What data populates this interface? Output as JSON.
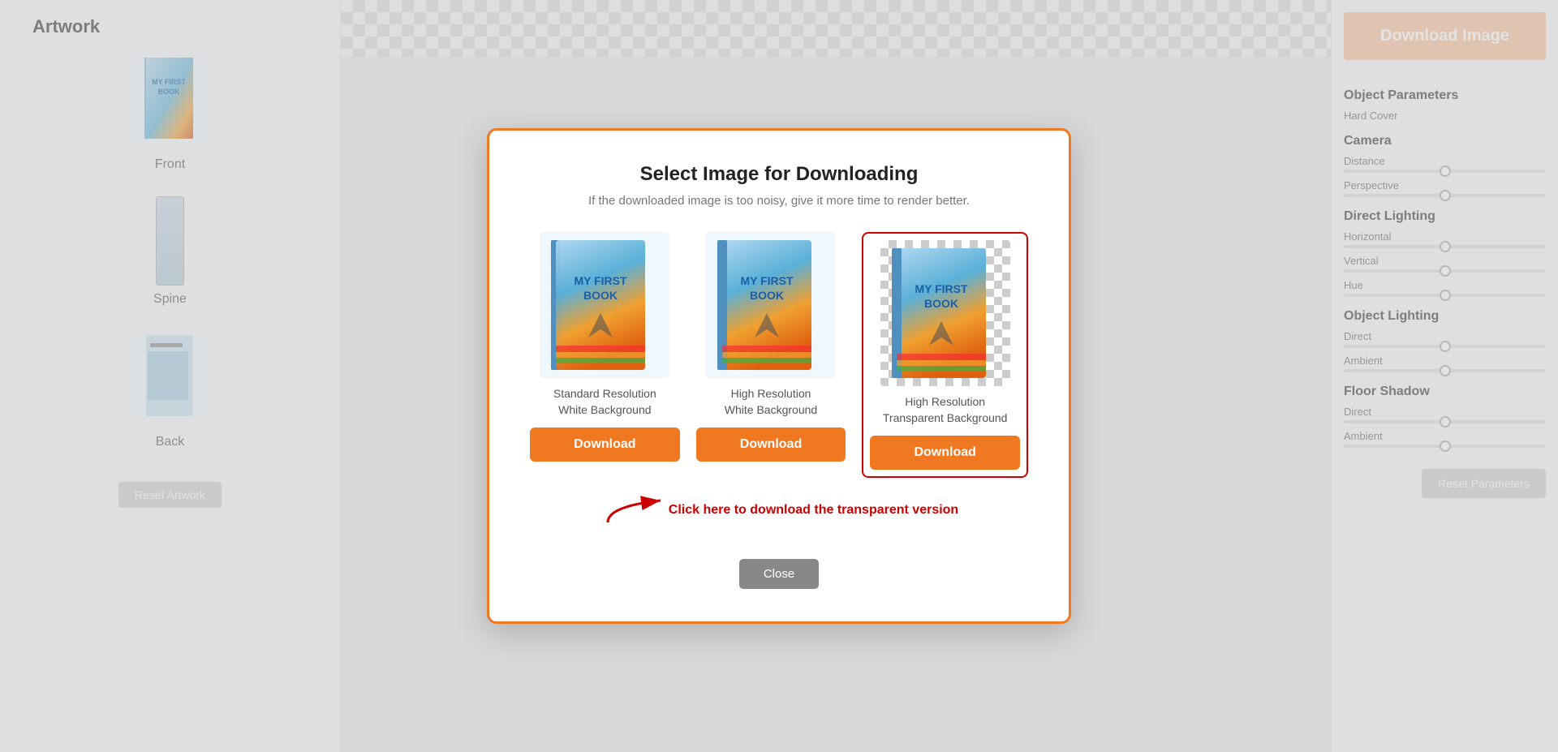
{
  "sidebar": {
    "title": "Artwork",
    "items": [
      {
        "label": "Front",
        "type": "front"
      },
      {
        "label": "Spine",
        "type": "spine"
      },
      {
        "label": "Back",
        "type": "back"
      }
    ],
    "reset_button": "Reset Artwork"
  },
  "header": {
    "download_image_button": "Download Image"
  },
  "right_panel": {
    "sections": [
      {
        "title": "Object Parameters",
        "subsection": "Hard Cover"
      },
      {
        "title": "Camera",
        "items": [
          "Distance",
          "Perspective"
        ]
      },
      {
        "title": "Direct Lighting",
        "items": [
          "Horizontal",
          "Vertical",
          "Hue"
        ]
      },
      {
        "title": "Object Lighting",
        "items": [
          "Direct",
          "Ambient"
        ]
      },
      {
        "title": "Floor Shadow",
        "items": [
          "Direct",
          "Ambient"
        ]
      }
    ],
    "reset_params_button": "Reset Parameters"
  },
  "modal": {
    "title": "Select Image for Downloading",
    "subtitle": "If the downloaded image is too noisy, give it more time to render better.",
    "options": [
      {
        "id": "standard",
        "label_line1": "Standard Resolution",
        "label_line2": "White Background",
        "button_label": "Download",
        "highlighted": false
      },
      {
        "id": "high",
        "label_line1": "High Resolution",
        "label_line2": "White Background",
        "button_label": "Download",
        "highlighted": false
      },
      {
        "id": "transparent",
        "label_line1": "High Resolution",
        "label_line2": "Transparent Background",
        "button_label": "Download",
        "highlighted": true
      }
    ],
    "hint_text": "Click here to download the transparent version",
    "close_button": "Close"
  },
  "book": {
    "title_line1": "MY FIRST",
    "title_line2": "BOOK"
  }
}
